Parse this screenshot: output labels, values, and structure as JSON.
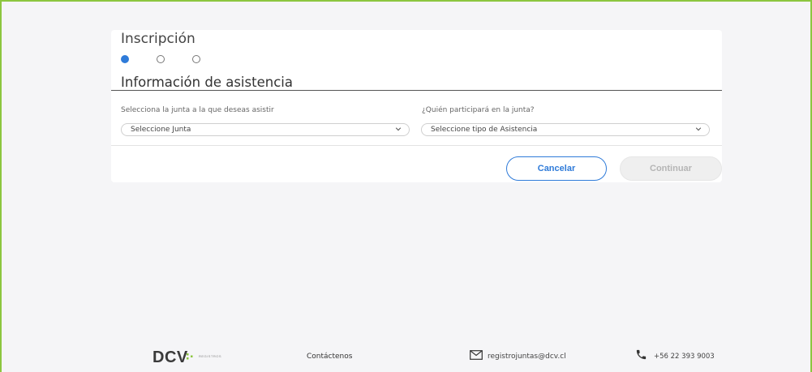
{
  "card": {
    "title": "Inscripción",
    "section_title": "Información de asistencia",
    "steps": [
      "active",
      "inactive",
      "inactive"
    ]
  },
  "form": {
    "junta_label": "Selecciona la junta a la que deseas asistir",
    "junta_value": "Seleccione Junta",
    "participant_label": "¿Quién participará en la junta?",
    "participant_value": "Seleccione tipo de Asistencia"
  },
  "actions": {
    "cancel_label": "Cancelar",
    "continue_label": "Continuar"
  },
  "footer": {
    "logo_text": "DCV",
    "logo_sub": "REGISTROS",
    "contact_label": "Contáctenos",
    "email": "registrojuntas@dcv.cl",
    "phone": "+56 22 393 9003"
  },
  "colors": {
    "accent": "#2f7bd9",
    "frame_border": "#8cc63f",
    "logo_green": "#8cc63f"
  }
}
